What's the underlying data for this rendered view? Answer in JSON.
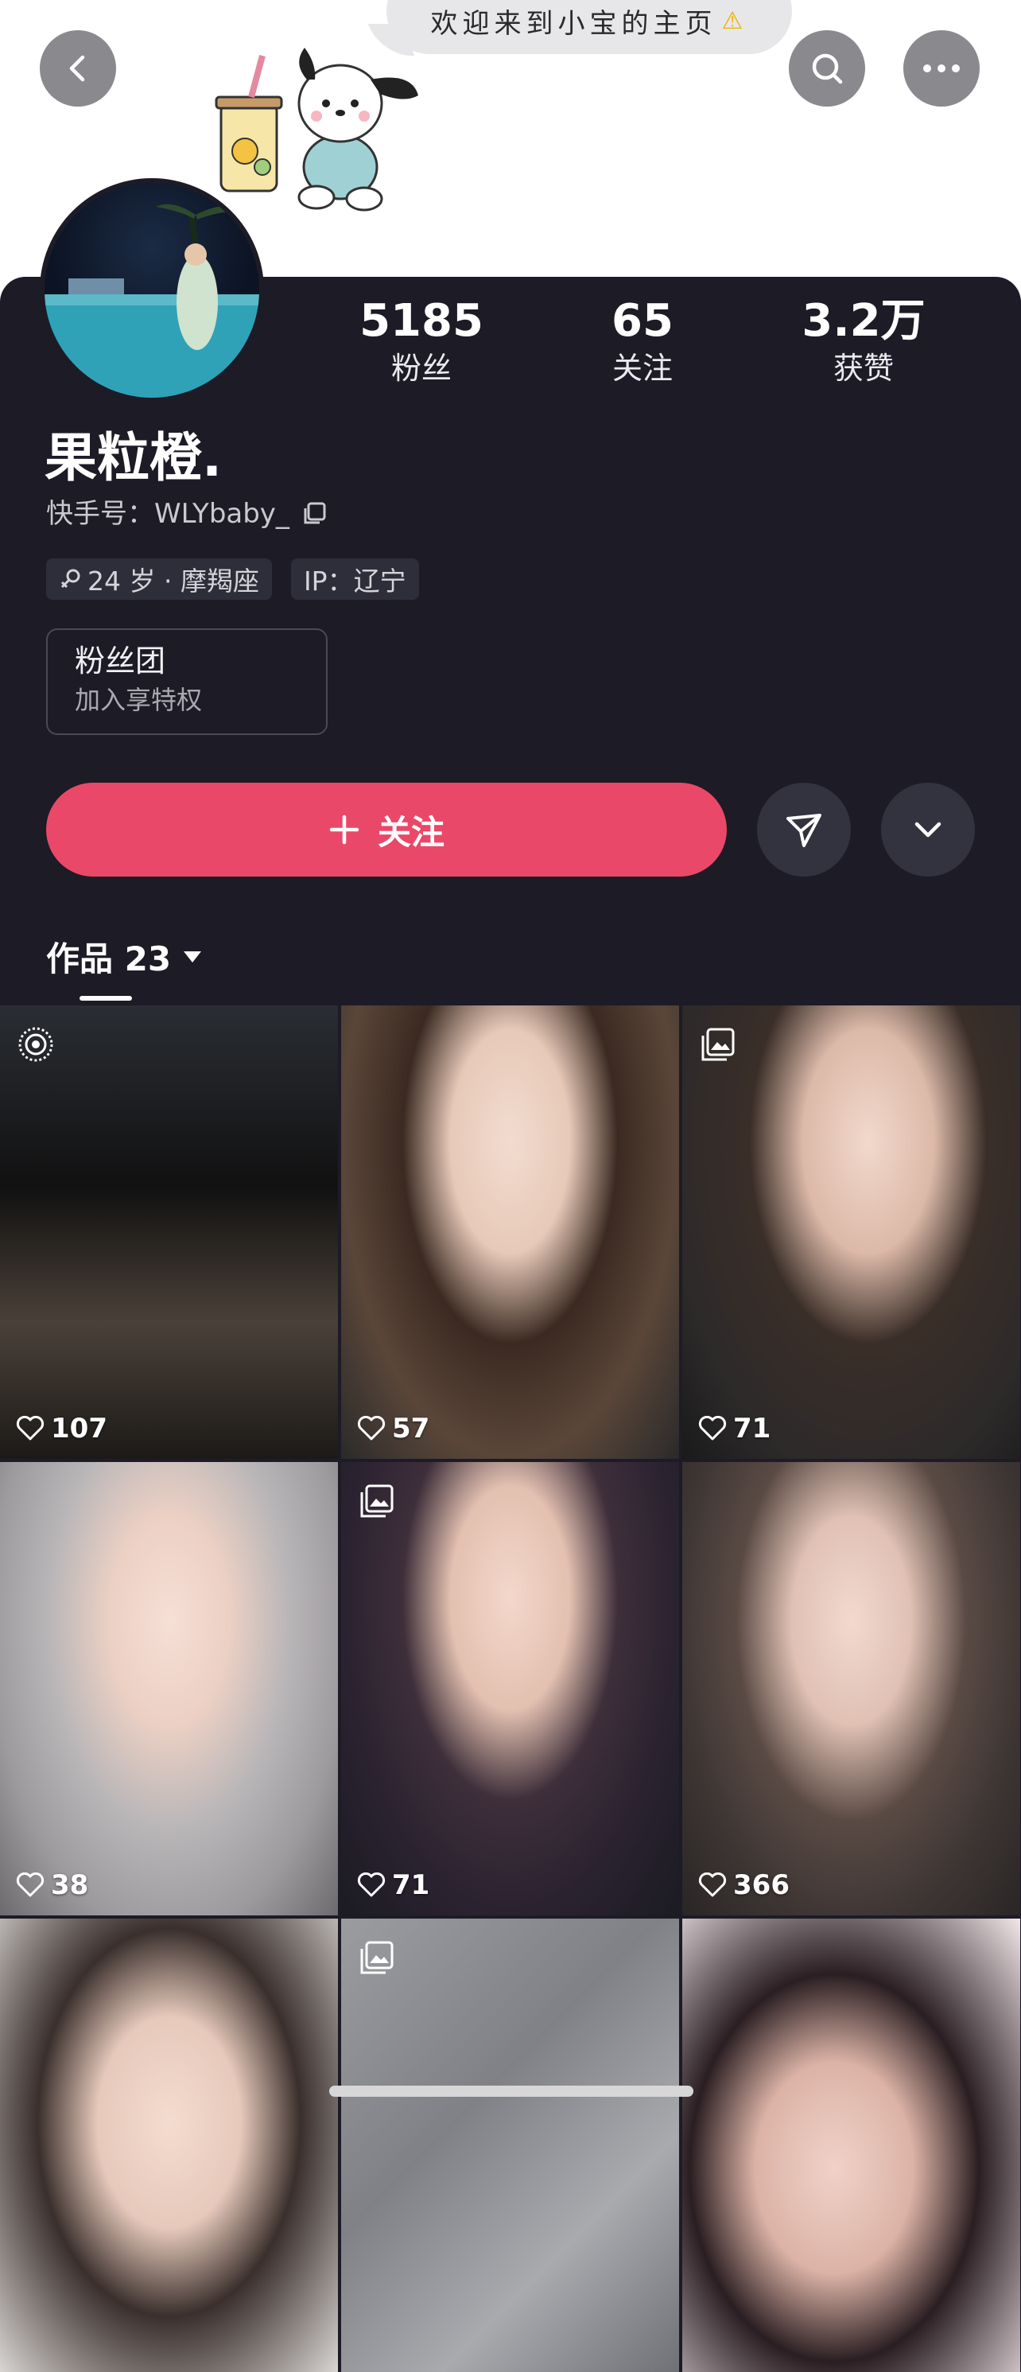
{
  "header": {
    "greeting": "欢迎来到小宝的主页",
    "warning_glyph": "⚠"
  },
  "profile": {
    "stats": [
      {
        "value": "5185",
        "label": "粉丝"
      },
      {
        "value": "65",
        "label": "关注"
      },
      {
        "value": "3.2万",
        "label": "获赞"
      }
    ],
    "name": "果粒橙.",
    "kuaishou_id": "快手号：WLYbaby_",
    "tags": [
      {
        "text": "24 岁 · 摩羯座",
        "icon": "female-icon"
      },
      {
        "text": "IP：辽宁",
        "icon": ""
      }
    ],
    "fan_club": {
      "title": "粉丝团",
      "subtitle": "加入享特权"
    }
  },
  "actions": {
    "follow_label": "关注"
  },
  "works": {
    "tab_label": "作品 23"
  },
  "videos": [
    {
      "likes": "107",
      "badge": "live-photo-icon",
      "tone": "dark-car"
    },
    {
      "likes": "57",
      "badge": "",
      "tone": "girl-light"
    },
    {
      "likes": "71",
      "badge": "gallery-icon",
      "tone": "girl-gray"
    },
    {
      "likes": "38",
      "badge": "",
      "tone": "girl-hoodie"
    },
    {
      "likes": "71",
      "badge": "gallery-icon",
      "tone": "girl-dark"
    },
    {
      "likes": "366",
      "badge": "",
      "tone": "girl-cat"
    },
    {
      "likes": "",
      "badge": "",
      "tone": "girl-bottom-1"
    },
    {
      "likes": "",
      "badge": "gallery-icon",
      "tone": "marble"
    },
    {
      "likes": "",
      "badge": "",
      "tone": "girl-bottom-3"
    }
  ],
  "colors": {
    "accent": "#ea4868",
    "background": "#1c1b26",
    "button_dark": "#33323f"
  }
}
